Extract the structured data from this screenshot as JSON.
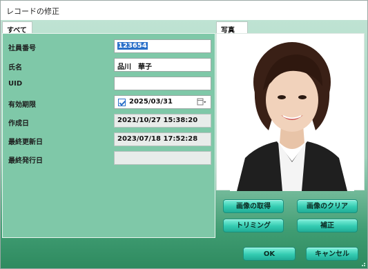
{
  "window": {
    "title": "レコードの修正"
  },
  "tabs": {
    "left": "すべて",
    "right": "写真"
  },
  "fields": [
    {
      "label": "社員番号",
      "value": "123654",
      "readonly": false,
      "selected": true
    },
    {
      "label": "氏名",
      "value": "品川　華子",
      "readonly": false
    },
    {
      "label": "UID",
      "value": "",
      "readonly": false
    },
    {
      "label": "有効期限",
      "value": "2025/03/31",
      "readonly": false,
      "checked": true
    },
    {
      "label": "作成日",
      "value": "2021/10/27 15:38:20",
      "readonly": true
    },
    {
      "label": "最終更新日",
      "value": "2023/07/18 17:52:28",
      "readonly": true
    },
    {
      "label": "最終発行日",
      "value": "",
      "readonly": true
    }
  ],
  "photo_buttons": {
    "get": "画像の取得",
    "clear": "画像のクリア",
    "trim": "トリミング",
    "fix": "補正"
  },
  "dialog_buttons": {
    "ok": "OK",
    "cancel": "キャンセル"
  },
  "icons": {
    "calendar": "calendar-dropdown-icon",
    "resize": "resize-grip-icon"
  },
  "colors": {
    "accent_teal": "#33cbb1",
    "panel_green": "#7fc8a8",
    "selection_blue": "#2a6fc9"
  }
}
